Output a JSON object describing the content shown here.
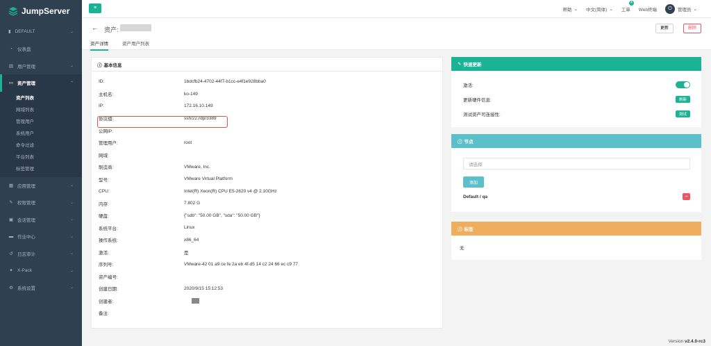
{
  "brand": {
    "name": "JumpServer"
  },
  "sidebar": {
    "org": "DEFAULT",
    "items": [
      {
        "label": "仪表盘",
        "icon": "dashboard-icon",
        "glyph": "◔"
      },
      {
        "label": "用户管理",
        "icon": "users-icon",
        "glyph": "▤"
      },
      {
        "label": "资产管理",
        "icon": "inbox-icon",
        "glyph": "▭"
      },
      {
        "label": "应用管理",
        "icon": "apps-icon",
        "glyph": "▦"
      },
      {
        "label": "权限管理",
        "icon": "permission-icon",
        "glyph": "✎"
      },
      {
        "label": "会话管理",
        "icon": "session-icon",
        "glyph": "▣"
      },
      {
        "label": "作业中心",
        "icon": "job-icon",
        "glyph": "▬"
      },
      {
        "label": "日志审计",
        "icon": "audit-icon",
        "glyph": "↺"
      },
      {
        "label": "X-Pack",
        "icon": "xpack-icon",
        "glyph": "✦"
      },
      {
        "label": "系统设置",
        "icon": "settings-icon",
        "glyph": "⚙"
      }
    ],
    "sub_items": [
      "资产列表",
      "网域列表",
      "管理用户",
      "系统用户",
      "命令过滤",
      "平台列表",
      "标签管理"
    ]
  },
  "topbar": {
    "help": "帮助",
    "language": "中文(简体)",
    "tickets": "工单",
    "ticket_count": "4",
    "web_terminal": "Web终端",
    "user": "管理员",
    "avatar_letter": "⏻"
  },
  "header": {
    "back": "←",
    "title": "资产: ",
    "update_button": "更新",
    "delete_button": "删除",
    "tabs": [
      "资产详情",
      "资产用户列表"
    ]
  },
  "basic": {
    "title": "基本信息",
    "rows": [
      {
        "key": "ID:",
        "value": "1bdcfb24-4702-44f7-b1cc-e4f1e928bba0"
      },
      {
        "key": "主机名:",
        "value": "ko-149"
      },
      {
        "key": "IP:",
        "value": "172.16.10.149"
      },
      {
        "key": "协议组:",
        "value": "ssh/22,rdp/3389"
      },
      {
        "key": "公网IP:",
        "value": ""
      },
      {
        "key": "管理用户:",
        "value": "root"
      },
      {
        "key": "网域:",
        "value": ""
      },
      {
        "key": "制造商:",
        "value": "VMware, Inc."
      },
      {
        "key": "型号:",
        "value": "VMware Virtual Platform"
      },
      {
        "key": "CPU:",
        "value": "Intel(R) Xeon(R) CPU E5-2620 v4 @ 2.10GHz"
      },
      {
        "key": "内存:",
        "value": "7.802 G"
      },
      {
        "key": "硬盘:",
        "value": "{\"sdb\": \"50.00 GB\", \"sda\": \"50.00 GB\"}"
      },
      {
        "key": "系统平台:",
        "value": "Linux"
      },
      {
        "key": "操作系统:",
        "value": "x86_64"
      },
      {
        "key": "激活:",
        "value": "是"
      },
      {
        "key": "序列号:",
        "value": "VMware-42 01 a9 ce fe 2a eb 4f-d5 14 c2 24 66 ec c9 77"
      },
      {
        "key": "资产编号:",
        "value": ""
      },
      {
        "key": "创建日期:",
        "value": "2020/9/15 15:12:53"
      },
      {
        "key": "创建者:",
        "value": ""
      },
      {
        "key": "备注:",
        "value": ""
      }
    ]
  },
  "quick_update": {
    "title": "快速更新",
    "active_label": "激活:",
    "active": true,
    "hardware_label": "更新硬件信息:",
    "hardware_button": "刷新",
    "test_label": "测试资产可连接性:",
    "test_button": "测试"
  },
  "nodes": {
    "title": "节点",
    "placeholder": "请选择",
    "add_button": "添加",
    "current": "Default / qa",
    "remove_glyph": "−"
  },
  "labels": {
    "title": "标签",
    "empty": "无"
  },
  "footer": {
    "version_label": "Version",
    "version": "v2.4.0-rc3"
  },
  "colors": {
    "accent": "#1ab394",
    "sidebar": "#2f4050",
    "danger": "#ed5565",
    "teal": "#5bc0c9",
    "orange": "#f0ad5e"
  }
}
